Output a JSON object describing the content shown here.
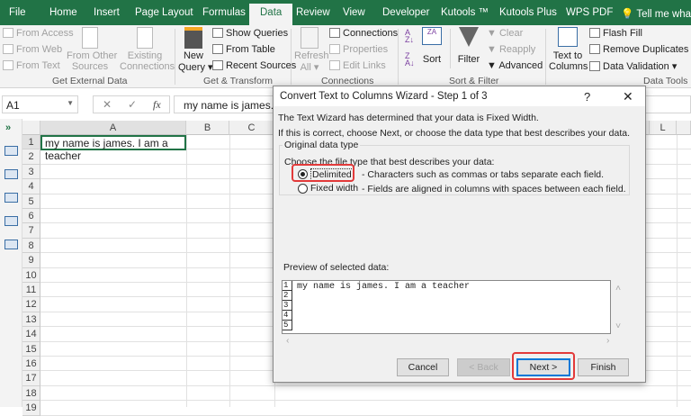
{
  "tabs": [
    "File",
    "Home",
    "Insert",
    "Page Layout",
    "Formulas",
    "Data",
    "Review",
    "View",
    "Developer",
    "Kutools ™",
    "Kutools Plus",
    "WPS PDF",
    "Tell me what you"
  ],
  "active_tab": "Data",
  "ribbon": {
    "get_external": {
      "from_access": "From Access",
      "from_web": "From Web",
      "from_text": "From Text",
      "from_other_1": "From Other",
      "from_other_2": "Sources",
      "existing_1": "Existing",
      "existing_2": "Connections",
      "label": "Get External Data"
    },
    "get_transform": {
      "new_1": "New",
      "new_2": "Query",
      "show_queries": "Show Queries",
      "from_table": "From Table",
      "recent_sources": "Recent Sources",
      "label": "Get & Transform"
    },
    "connections": {
      "refresh_1": "Refresh",
      "refresh_2": "All",
      "connections": "Connections",
      "properties": "Properties",
      "edit_links": "Edit Links",
      "label": "Connections"
    },
    "sort_filter": {
      "sort": "Sort",
      "filter": "Filter",
      "clear": "Clear",
      "reapply": "Reapply",
      "advanced": "Advanced",
      "label": "Sort & Filter"
    },
    "data_tools": {
      "ttc_1": "Text to",
      "ttc_2": "Columns",
      "flash_fill": "Flash Fill",
      "remove_duplicates": "Remove Duplicates",
      "data_validation": "Data Validation",
      "label": "Data Tools"
    }
  },
  "formula_bar": {
    "name_box": "A1",
    "cancel": "✕",
    "enter": "✓",
    "fx": "fx",
    "value": "my name is james. I"
  },
  "columns": [
    "A",
    "B",
    "C",
    "L"
  ],
  "rows": [
    "1",
    "2",
    "3",
    "4",
    "5",
    "6",
    "7",
    "8",
    "9",
    "10",
    "11",
    "12",
    "13",
    "14",
    "15",
    "16",
    "17",
    "18",
    "19"
  ],
  "cell_a1": "my name is james. I am a teacher",
  "dialog": {
    "title": "Convert Text to Columns Wizard - Step 1 of 3",
    "help": "?",
    "close": "✕",
    "line1": "The Text Wizard has determined that your data is Fixed Width.",
    "line2": "If this is correct, choose Next, or choose the data type that best describes your data.",
    "group_label": "Original data type",
    "choose": "Choose the file type that best describes your data:",
    "delimited": "Delimited",
    "delimited_desc": "- Characters such as commas or tabs separate each field.",
    "fixed": "Fixed width",
    "fixed_desc": "- Fields are aligned in columns with spaces between each field.",
    "selected": "Delimited",
    "preview_label": "Preview of selected data:",
    "preview_rows": [
      "1",
      "2",
      "3",
      "4",
      "5"
    ],
    "preview_text": "my name is james. I am a teacher",
    "buttons": {
      "cancel": "Cancel",
      "back": "< Back",
      "next": "Next >",
      "finish": "Finish"
    }
  },
  "colors": {
    "excel_green": "#217346",
    "highlight_red": "#e23a3a"
  }
}
